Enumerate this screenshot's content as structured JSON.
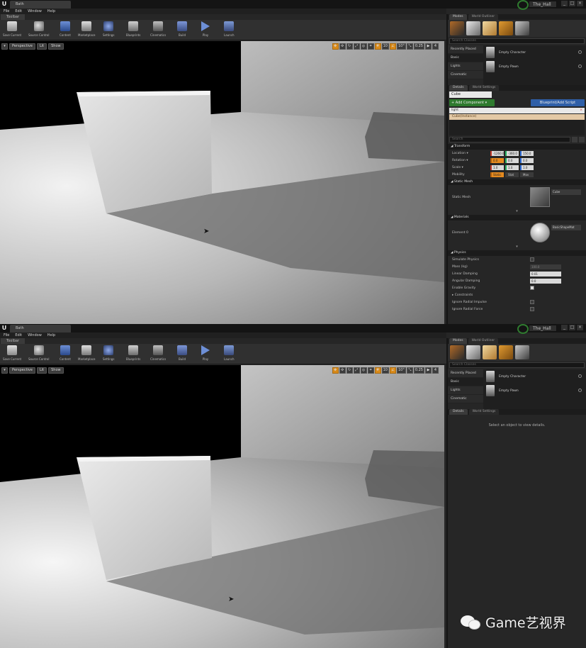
{
  "title_bar": {
    "doc_tab": "Bath",
    "project_name": "The_Hall",
    "window_buttons": [
      "_",
      "□",
      "×"
    ]
  },
  "menu": [
    "File",
    "Edit",
    "Window",
    "Help"
  ],
  "toolbar_tab": "Toolbar",
  "toolbar": [
    {
      "id": "save",
      "label": "Save Current",
      "icon": "save-icon"
    },
    {
      "id": "src",
      "label": "Source Control",
      "icon": "source-control-icon"
    },
    {
      "id": "content",
      "label": "Content",
      "icon": "content-icon"
    },
    {
      "id": "market",
      "label": "Marketplace",
      "icon": "marketplace-icon"
    },
    {
      "id": "settings",
      "label": "Settings",
      "icon": "settings-icon"
    },
    {
      "id": "blueprints",
      "label": "Blueprints",
      "icon": "blueprints-icon"
    },
    {
      "id": "cinematics",
      "label": "Cinematics",
      "icon": "cinematics-icon"
    },
    {
      "id": "build",
      "label": "Build",
      "icon": "build-icon"
    },
    {
      "id": "play",
      "label": "Play",
      "icon": "play-icon"
    },
    {
      "id": "launch",
      "label": "Launch",
      "icon": "launch-icon"
    }
  ],
  "viewport": {
    "menu_glyph": "▾",
    "perspective": "Perspective",
    "lit": "Lit",
    "show": "Show",
    "angle": "10°",
    "scale": "0.25",
    "camera_speed": "4"
  },
  "modes": {
    "tab": "Modes",
    "outliner_tab": "World Outliner",
    "search_placeholder": "Search Classes",
    "categories": [
      "Recently Placed",
      "Basic",
      "Lights",
      "Cinematic"
    ],
    "items": [
      "Empty Character",
      "Empty Pawn"
    ]
  },
  "details": {
    "tab": "Details",
    "settings_tab": "World Settings",
    "actor_name": "Cube",
    "add_component": "+ Add Component ▾",
    "blueprint_script": "Blueprint/Add Script",
    "component_search": "light",
    "component_entry": "Cube(Instance)",
    "search_placeholder": "Search",
    "sections": {
      "transform": "Transform",
      "static_mesh": "Static Mesh",
      "materials": "Materials",
      "physics": "Physics"
    },
    "transform": {
      "location_label": "Location ▾",
      "location": [
        "-1260.0",
        "-360.0",
        "150.0"
      ],
      "rotation_label": "Rotation ▾",
      "rotation": [
        "0.0",
        "0.0",
        "0.0"
      ],
      "scale_label": "Scale ▾",
      "scale": [
        "1.0",
        "1.0",
        "1.0"
      ],
      "mobility_label": "Mobility",
      "mobility": [
        "Static",
        "Stat",
        "Mov"
      ]
    },
    "static_mesh_label": "Static Mesh",
    "static_mesh_value": "Cube",
    "element_label": "Element 0",
    "material_value": "BasicShapeMat",
    "material_sub": "Textures",
    "physics": {
      "simulate": "Simulate Physics",
      "mass": "Mass (kg)",
      "mass_value": "100.0",
      "linear_damping": "Linear Damping",
      "linear_value": "0.01",
      "angular_damping": "Angular Damping",
      "angular_value": "0.0",
      "gravity": "Enable Gravity",
      "constraints": "▸ Constraints",
      "ignore_radial_impulse": "Ignore Radial Impulse",
      "ignore_radial_force": "Ignore Radial Force"
    },
    "empty_message": "Select an object to view details."
  },
  "watermark": "Game艺视界",
  "colors": {
    "add_component": "#2e7a2e",
    "blueprint": "#2f5fa8",
    "accent_orange": "#d88a1a"
  }
}
